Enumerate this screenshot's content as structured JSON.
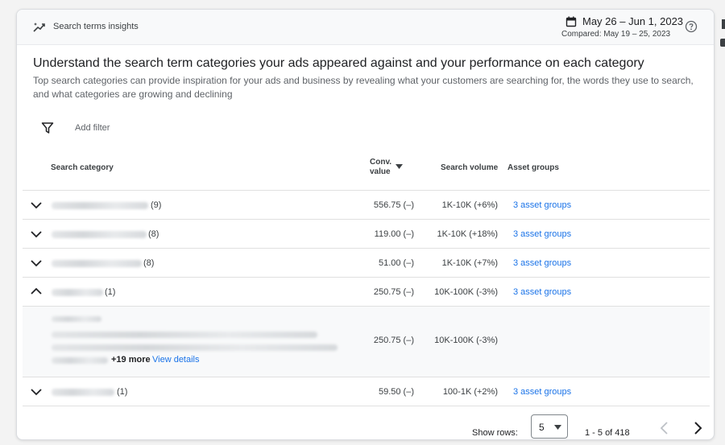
{
  "header": {
    "insights_label": "Search terms insights",
    "date_range": "May 26 – Jun 1, 2023",
    "compared": "Compared: May 19 – 25, 2023"
  },
  "main": {
    "title": "Understand the search term categories your ads appeared against and your performance on each category",
    "subtitle": "Top search categories can provide inspiration for your ads and business by revealing what your customers are searching for, the words they use to search, and what categories are growing and declining"
  },
  "filter": {
    "label": "Add filter"
  },
  "table": {
    "headers": {
      "category": "Search category",
      "conv_line1": "Conv.",
      "conv_line2": "value",
      "volume": "Search volume",
      "assets": "Asset groups"
    },
    "rows": [
      {
        "count": "(9)",
        "conv": "556.75 (–)",
        "volume": "1K-10K (+6%)",
        "assets": "3 asset groups"
      },
      {
        "count": "(8)",
        "conv": "119.00 (–)",
        "volume": "1K-10K (+18%)",
        "assets": "3 asset groups"
      },
      {
        "count": "(8)",
        "conv": "51.00 (–)",
        "volume": "1K-10K (+7%)",
        "assets": "3 asset groups"
      },
      {
        "count": "(1)",
        "conv": "250.75 (–)",
        "volume": "10K-100K (-3%)",
        "assets": "3 asset groups"
      },
      {
        "count": "(1)",
        "conv": "59.50 (–)",
        "volume": "100-1K (+2%)",
        "assets": "3 asset groups"
      }
    ],
    "detail": {
      "more": "+19 more",
      "view_details": "View details",
      "conv": "250.75 (–)",
      "volume": "10K-100K (-3%)"
    }
  },
  "footer": {
    "show_rows_label": "Show rows:",
    "rows_value": "5",
    "page_range": "1 - 5 of 418"
  },
  "colors": {
    "link": "#1a73e8",
    "header_bg": "#f8f9fa",
    "divider": "#e0e0e0"
  }
}
